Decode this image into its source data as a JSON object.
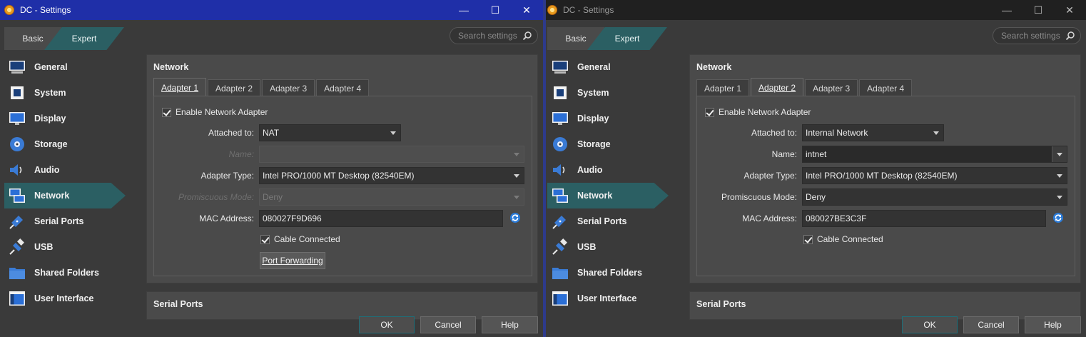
{
  "windows": [
    {
      "title": "DC - Settings",
      "mode_tabs": {
        "basic": "Basic",
        "expert": "Expert"
      },
      "search_placeholder": "Search settings",
      "nav": [
        "General",
        "System",
        "Display",
        "Storage",
        "Audio",
        "Network",
        "Serial Ports",
        "USB",
        "Shared Folders",
        "User Interface"
      ],
      "active_nav": "Network",
      "section_title": "Network",
      "adapter_tabs": [
        "Adapter 1",
        "Adapter 2",
        "Adapter 3",
        "Adapter 4"
      ],
      "active_tab": "Adapter 1",
      "enable_label": "Enable Network Adapter",
      "attached_label": "Attached to:",
      "attached_value": "NAT",
      "name_label": "Name:",
      "name_value": "",
      "name_enabled": false,
      "adapter_type_label": "Adapter Type:",
      "adapter_type_value": "Intel PRO/1000 MT Desktop (82540EM)",
      "promiscuous_label": "Promiscuous Mode:",
      "promiscuous_value": "Deny",
      "promiscuous_enabled": false,
      "mac_label": "MAC Address:",
      "mac_value": "080027F9D696",
      "cable_label": "Cable Connected",
      "port_forwarding_label": "Port Forwarding",
      "next_section_title": "Serial Ports",
      "ok_label": "OK",
      "cancel_label": "Cancel",
      "help_label": "Help"
    },
    {
      "title": "DC - Settings",
      "mode_tabs": {
        "basic": "Basic",
        "expert": "Expert"
      },
      "search_placeholder": "Search settings",
      "nav": [
        "General",
        "System",
        "Display",
        "Storage",
        "Audio",
        "Network",
        "Serial Ports",
        "USB",
        "Shared Folders",
        "User Interface"
      ],
      "active_nav": "Network",
      "section_title": "Network",
      "adapter_tabs": [
        "Adapter 1",
        "Adapter 2",
        "Adapter 3",
        "Adapter 4"
      ],
      "active_tab": "Adapter 2",
      "enable_label": "Enable Network Adapter",
      "attached_label": "Attached to:",
      "attached_value": "Internal Network",
      "name_label": "Name:",
      "name_value": "intnet",
      "name_enabled": true,
      "adapter_type_label": "Adapter Type:",
      "adapter_type_value": "Intel PRO/1000 MT Desktop (82540EM)",
      "promiscuous_label": "Promiscuous Mode:",
      "promiscuous_value": "Deny",
      "promiscuous_enabled": true,
      "mac_label": "MAC Address:",
      "mac_value": "080027BE3C3F",
      "cable_label": "Cable Connected",
      "next_section_title": "Serial Ports",
      "ok_label": "OK",
      "cancel_label": "Cancel",
      "help_label": "Help"
    }
  ],
  "colors": {
    "accent": "#2b5f63",
    "active_titlebar": "#1f2fa8",
    "inactive_titlebar": "#202020",
    "background": "#3a3a3a"
  },
  "icons": [
    "app-icon",
    "minimize-icon",
    "maximize-icon",
    "close-icon",
    "search-icon",
    "general-icon",
    "system-icon",
    "display-icon",
    "storage-icon",
    "audio-icon",
    "network-icon",
    "serial-ports-icon",
    "usb-icon",
    "shared-folders-icon",
    "user-interface-icon",
    "refresh-mac-icon",
    "checkbox-checked-icon"
  ]
}
